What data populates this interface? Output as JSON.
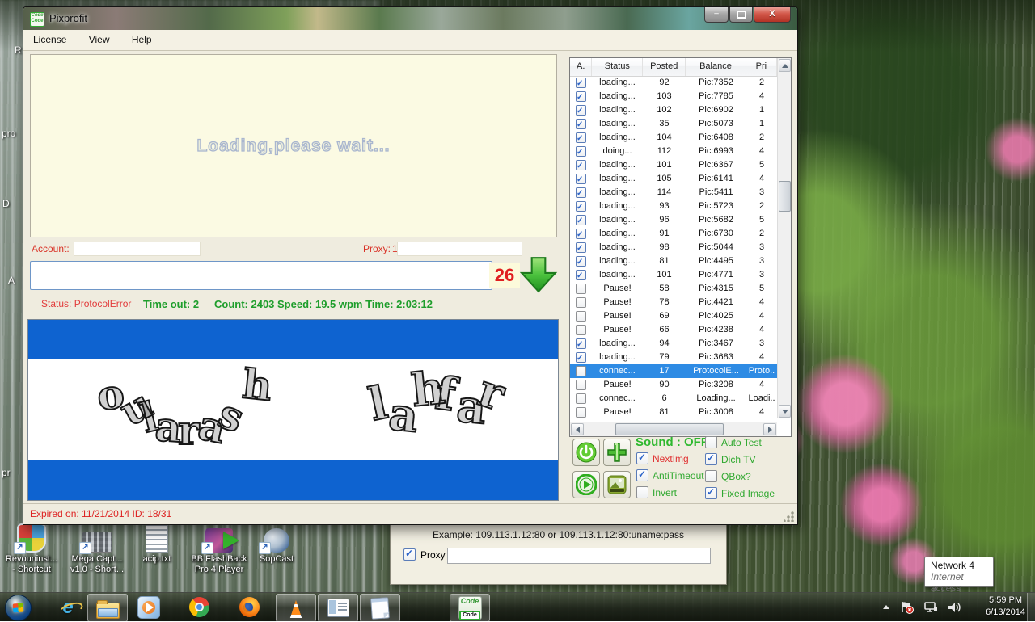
{
  "colors": {
    "captcha_blue": "#0e63d0",
    "selection_blue": "#2e8be4",
    "status_green": "#1f9e2c",
    "label_red": "#d93025",
    "control_green": "#2fa82f",
    "client_cream": "#efecdf",
    "browser_cream": "#fbfae3"
  },
  "desktop": {
    "edge_fragments": [
      "R",
      "pro",
      "D",
      "A",
      "pr"
    ],
    "shortcuts": [
      {
        "line1": "Revouninst...",
        "line2": "- Shortcut"
      },
      {
        "line1": "Mega.Capt...",
        "line2": "v1.0 - Short..."
      },
      {
        "line1": "acip.txt",
        "line2": ""
      },
      {
        "line1": "BB FlashBack",
        "line2": "Pro 4 Player"
      },
      {
        "line1": "SopCast",
        "line2": ""
      }
    ]
  },
  "window": {
    "title": "Pixprofit",
    "code_badge": "Code",
    "caption": {
      "minimize": "–",
      "close": "X"
    },
    "menu": [
      "License",
      "View",
      "Help"
    ],
    "browser_text": "Loading,please wait...",
    "account_label": "Account:",
    "account_value": "",
    "proxy_label": "Proxy:",
    "proxy_fragment": "1",
    "proxy_value": "",
    "captcha_input_value": "",
    "counter": "26",
    "status": "Status: ProtocolError",
    "timeout": "Time out: 2",
    "stats": "Count: 2403 Speed: 19.5 wpm Time: 2:03:12",
    "captcha_words": [
      "oularash",
      "lahfar"
    ],
    "statusbar": "Expired on: 11/21/2014  ID: 18/31",
    "table": {
      "headers": [
        "A.",
        "Status",
        "Posted",
        "Balance",
        "Pri"
      ],
      "rows": [
        {
          "checked": true,
          "status": "loading...",
          "posted": "92",
          "balance": "Pic:7352",
          "pri": "2",
          "selected": false
        },
        {
          "checked": true,
          "status": "loading...",
          "posted": "103",
          "balance": "Pic:7785",
          "pri": "4",
          "selected": false
        },
        {
          "checked": true,
          "status": "loading...",
          "posted": "102",
          "balance": "Pic:6902",
          "pri": "1",
          "selected": false
        },
        {
          "checked": true,
          "status": "loading...",
          "posted": "35",
          "balance": "Pic:5073",
          "pri": "1",
          "selected": false
        },
        {
          "checked": true,
          "status": "loading...",
          "posted": "104",
          "balance": "Pic:6408",
          "pri": "2",
          "selected": false
        },
        {
          "checked": true,
          "status": "doing...",
          "posted": "112",
          "balance": "Pic:6993",
          "pri": "4",
          "selected": false
        },
        {
          "checked": true,
          "status": "loading...",
          "posted": "101",
          "balance": "Pic:6367",
          "pri": "5",
          "selected": false
        },
        {
          "checked": true,
          "status": "loading...",
          "posted": "105",
          "balance": "Pic:6141",
          "pri": "4",
          "selected": false
        },
        {
          "checked": true,
          "status": "loading...",
          "posted": "114",
          "balance": "Pic:5411",
          "pri": "3",
          "selected": false
        },
        {
          "checked": true,
          "status": "loading...",
          "posted": "93",
          "balance": "Pic:5723",
          "pri": "2",
          "selected": false
        },
        {
          "checked": true,
          "status": "loading...",
          "posted": "96",
          "balance": "Pic:5682",
          "pri": "5",
          "selected": false
        },
        {
          "checked": true,
          "status": "loading...",
          "posted": "91",
          "balance": "Pic:6730",
          "pri": "2",
          "selected": false
        },
        {
          "checked": true,
          "status": "loading...",
          "posted": "98",
          "balance": "Pic:5044",
          "pri": "3",
          "selected": false
        },
        {
          "checked": true,
          "status": "loading...",
          "posted": "81",
          "balance": "Pic:4495",
          "pri": "3",
          "selected": false
        },
        {
          "checked": true,
          "status": "loading...",
          "posted": "101",
          "balance": "Pic:4771",
          "pri": "3",
          "selected": false
        },
        {
          "checked": false,
          "status": "Pause!",
          "posted": "58",
          "balance": "Pic:4315",
          "pri": "5",
          "selected": false
        },
        {
          "checked": false,
          "status": "Pause!",
          "posted": "78",
          "balance": "Pic:4421",
          "pri": "4",
          "selected": false
        },
        {
          "checked": false,
          "status": "Pause!",
          "posted": "69",
          "balance": "Pic:4025",
          "pri": "4",
          "selected": false
        },
        {
          "checked": false,
          "status": "Pause!",
          "posted": "66",
          "balance": "Pic:4238",
          "pri": "4",
          "selected": false
        },
        {
          "checked": true,
          "status": "loading...",
          "posted": "94",
          "balance": "Pic:3467",
          "pri": "3",
          "selected": false
        },
        {
          "checked": true,
          "status": "loading...",
          "posted": "79",
          "balance": "Pic:3683",
          "pri": "4",
          "selected": false
        },
        {
          "checked": false,
          "status": "connec...",
          "posted": "17",
          "balance": "ProtocolE...",
          "pri": "Proto..",
          "selected": true
        },
        {
          "checked": false,
          "status": "Pause!",
          "posted": "90",
          "balance": "Pic:3208",
          "pri": "4",
          "selected": false
        },
        {
          "checked": false,
          "status": "connec...",
          "posted": "6",
          "balance": "Loading...",
          "pri": "Loadi..",
          "selected": false
        },
        {
          "checked": false,
          "status": "Pause!",
          "posted": "81",
          "balance": "Pic:3008",
          "pri": "4",
          "selected": false
        }
      ]
    },
    "controls": {
      "sound_label": "Sound : OFF",
      "left": [
        {
          "label": "NextImg",
          "checked": true,
          "color": "#e03232"
        },
        {
          "label": "AntiTimeout",
          "checked": true,
          "color": "#2fa82f"
        },
        {
          "label": "Invert",
          "checked": false,
          "color": "#2fa82f"
        }
      ],
      "right": [
        {
          "label": "Auto Test",
          "checked": false,
          "color": "#2fa82f"
        },
        {
          "label": "Dịch TV",
          "checked": true,
          "color": "#2fa82f"
        },
        {
          "label": "QBox?",
          "checked": false,
          "color": "#2fa82f"
        },
        {
          "label": "Fixed Image",
          "checked": true,
          "color": "#2fa82f"
        }
      ]
    }
  },
  "proxy_dialog": {
    "example": "Example: 109.113.1.12:80 or 109.113.1.12:80:uname:pass",
    "label": "Proxy",
    "checked": true,
    "value": ""
  },
  "tooltip": {
    "line1": "Network 4",
    "line2": "Internet access"
  },
  "taskbar": {
    "icons": [
      "start-orb",
      "internet-explorer",
      "windows-explorer",
      "windows-media-player",
      "chrome",
      "firefox",
      "vlc",
      "app-window",
      "notepad",
      "pixprofit-code"
    ],
    "clock_time": "5:59 PM",
    "clock_date": "6/13/2014"
  }
}
